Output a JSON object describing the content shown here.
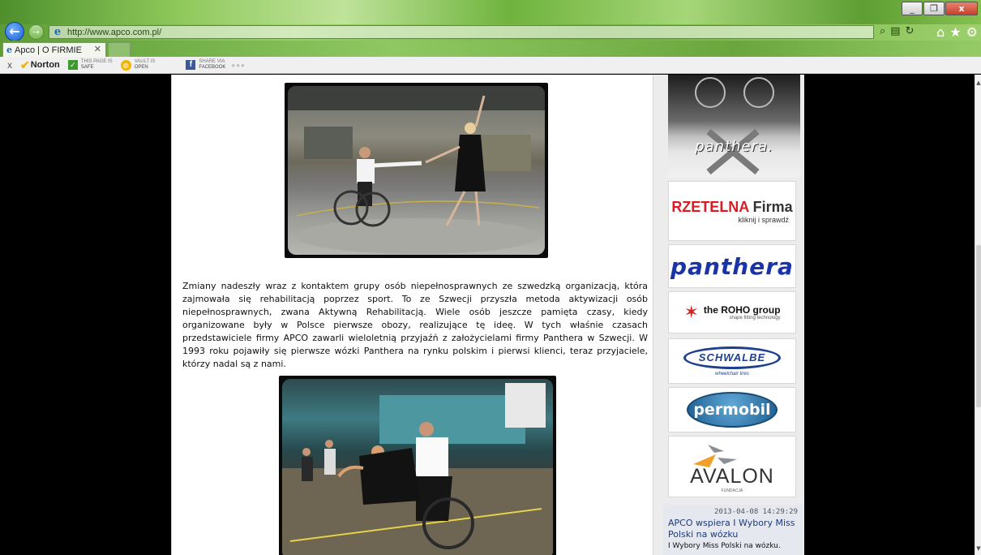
{
  "browser": {
    "url": "http://www.apco.com.pl/",
    "tab_title": "Apco | O FIRMIE",
    "window_buttons": [
      "_",
      "❐",
      "x"
    ],
    "toolbar": {
      "close": "x",
      "norton": "Norton",
      "safe_line1": "THIS PAGE IS",
      "safe_line2": "SAFE",
      "vault_line1": "VAULT IS",
      "vault_line2": "OPEN",
      "share_line1": "SHARE VIA",
      "share_line2": "FACEBOOK"
    }
  },
  "article": {
    "text": "Zmiany nadeszły wraz z kontaktem grupy osób niepełnosprawnych ze szwedzką organizacją, która zajmowała się rehabilitacją poprzez sport. To ze Szwecji przyszła metoda aktywizacji osób niepełnosprawnych, zwana Aktywną Rehabilitacją. Wiele osób jeszcze pamięta czasy, kiedy organizowane były w Polsce pierwsze obozy, realizujące tę ideę. W tych właśnie czasach przedstawiciele firmy APCO zawarli wieloletnią przyjaźń z założycielami firmy Panthera w Szwecji. W 1993 roku pojawiły się pierwsze wózki Panthera na rynku polskim i pierwsi klienci, teraz przyjaciele, którzy nadal są z nami."
  },
  "sidebar": {
    "panthera_photo_label": "panthera.",
    "rzetelna_main": "RZETELNA",
    "rzetelna_firma": "Firma",
    "rzetelna_sub": "kliknij i sprawdź",
    "panthera_logo": "panthera",
    "roho_title": "the ROHO group",
    "roho_sub": "shape fitting technology",
    "schwalbe": "SCHWALBE",
    "schwalbe_sub": "wheelchair tires",
    "permobil": "permobil",
    "avalon": "AVALON",
    "avalon_sub": "FUNDACJA",
    "news": {
      "date": "2013-04-08 14:29:29",
      "title": "APCO wspiera I Wybory Miss Polski na wózku",
      "lead": "I Wybory Miss Polski na wózku."
    }
  }
}
